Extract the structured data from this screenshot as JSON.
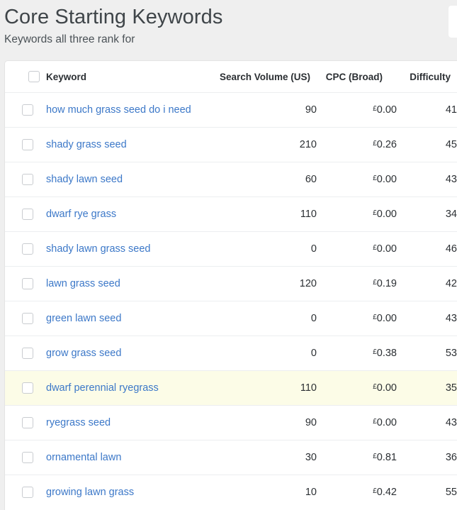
{
  "header": {
    "title": "Core Starting Keywords",
    "subtitle": "Keywords all three rank for"
  },
  "table": {
    "columns": {
      "select_all": "",
      "keyword": "Keyword",
      "volume": "Search Volume (US)",
      "cpc": "CPC (Broad)",
      "difficulty": "Difficulty"
    },
    "currency_symbol": "£",
    "rows": [
      {
        "keyword": "how much grass seed do i need",
        "volume": "90",
        "cpc": "0.00",
        "difficulty": "41",
        "highlighted": false
      },
      {
        "keyword": "shady grass seed",
        "volume": "210",
        "cpc": "0.26",
        "difficulty": "45",
        "highlighted": false
      },
      {
        "keyword": "shady lawn seed",
        "volume": "60",
        "cpc": "0.00",
        "difficulty": "43",
        "highlighted": false
      },
      {
        "keyword": "dwarf rye grass",
        "volume": "110",
        "cpc": "0.00",
        "difficulty": "34",
        "highlighted": false
      },
      {
        "keyword": "shady lawn grass seed",
        "volume": "0",
        "cpc": "0.00",
        "difficulty": "46",
        "highlighted": false
      },
      {
        "keyword": "lawn grass seed",
        "volume": "120",
        "cpc": "0.19",
        "difficulty": "42",
        "highlighted": false
      },
      {
        "keyword": "green lawn seed",
        "volume": "0",
        "cpc": "0.00",
        "difficulty": "43",
        "highlighted": false
      },
      {
        "keyword": "grow grass seed",
        "volume": "0",
        "cpc": "0.38",
        "difficulty": "53",
        "highlighted": false
      },
      {
        "keyword": "dwarf perennial ryegrass",
        "volume": "110",
        "cpc": "0.00",
        "difficulty": "35",
        "highlighted": true
      },
      {
        "keyword": "ryegrass seed",
        "volume": "90",
        "cpc": "0.00",
        "difficulty": "43",
        "highlighted": false
      },
      {
        "keyword": "ornamental lawn",
        "volume": "30",
        "cpc": "0.81",
        "difficulty": "36",
        "highlighted": false
      },
      {
        "keyword": "growing lawn grass",
        "volume": "10",
        "cpc": "0.42",
        "difficulty": "55",
        "highlighted": false
      }
    ]
  },
  "colors": {
    "page_background": "#efefef",
    "card_background": "#ffffff",
    "link": "#3c78c8",
    "text": "#2b2f33",
    "title": "#3f4549",
    "row_highlight": "#fcfce7",
    "row_divider": "#eceef0"
  }
}
